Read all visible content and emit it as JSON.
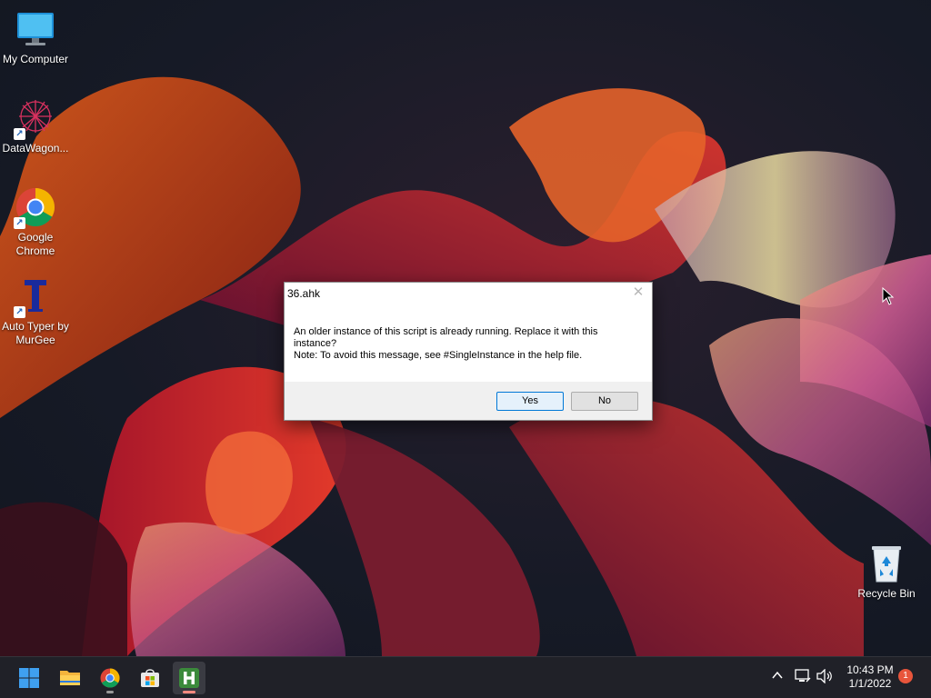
{
  "desktop": {
    "icons": [
      {
        "label": "My Computer",
        "icon": "monitor-icon"
      },
      {
        "label": "DataWagon...",
        "icon": "datawagon-icon",
        "shortcut": true
      },
      {
        "label": "Google Chrome",
        "icon": "chrome-icon",
        "shortcut": true
      },
      {
        "label": "Auto Typer by MurGee",
        "icon": "auto-typer-icon",
        "shortcut": true
      },
      {
        "label": "Recycle Bin",
        "icon": "recycle-bin-icon"
      }
    ]
  },
  "dialog": {
    "title": "36.ahk",
    "close_icon": "close-icon",
    "message_line1": "An older instance of this script is already running.  Replace it with this instance?",
    "message_line2": "Note: To avoid this message, see #SingleInstance in the help file.",
    "yes_label": "Yes",
    "no_label": "No"
  },
  "taskbar": {
    "apps": [
      {
        "name": "Start",
        "icon": "windows-start-icon"
      },
      {
        "name": "File Explorer",
        "icon": "folder-icon"
      },
      {
        "name": "Google Chrome",
        "icon": "chrome-icon"
      },
      {
        "name": "Microsoft Store",
        "icon": "store-icon"
      },
      {
        "name": "AutoHotkey",
        "icon": "autohotkey-icon",
        "active": true
      }
    ],
    "tray": {
      "overflow_icon": "chevron-up-icon",
      "network_icon": "network-icon",
      "volume_icon": "volume-icon",
      "time": "10:43 PM",
      "date": "1/1/2022",
      "notification_count": "1"
    }
  },
  "colors": {
    "taskbar_bg": "#202128",
    "accent": "#0078d7",
    "badge": "#e8553b"
  }
}
